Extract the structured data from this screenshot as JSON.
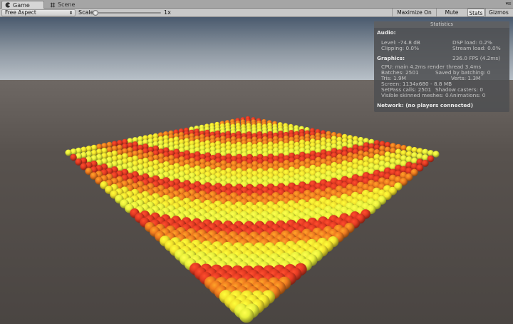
{
  "tabs": {
    "game": "Game",
    "scene": "Scene"
  },
  "toolbar": {
    "aspect": "Free Aspect",
    "scale_label": "Scale",
    "scale_value": "1x",
    "maximize_on_play": "Maximize On Play",
    "mute_audio": "Mute Audio",
    "stats": "Stats",
    "gizmos": "Gizmos"
  },
  "stats": {
    "title": "Statistics",
    "audio_header": "Audio:",
    "level": "Level: -74.8 dB",
    "clipping": "Clipping: 0.0%",
    "dsp_load": "DSP load: 0.2%",
    "stream_load": "Stream load: 0.0%",
    "graphics_header": "Graphics:",
    "fps": "236.0 FPS (4.2ms)",
    "cpu": "CPU: main 4.2ms  render thread 3.4ms",
    "batches": "Batches: 2501",
    "saved_by_batching": "Saved by batching: 0",
    "tris": "Tris: 1.9M",
    "verts": "Verts: 1.3M",
    "screen": "Screen: 1134x680 - 8.8 MB",
    "setpass": "SetPass calls: 2501",
    "shadow_casters": "Shadow casters: 0",
    "skinned_meshes": "Visible skinned meshes: 0",
    "animations": "Animations: 0",
    "network": "Network: (no players connected)"
  },
  "scene": {
    "sky_top": "#4a5a6e",
    "sky_mid": "#b8c0c8",
    "ground": "#55504c",
    "sphere_colors": [
      "#e33a22",
      "#ef7a1e",
      "#f2e22c",
      "#e8f03a"
    ]
  },
  "icons": {
    "game_tab": "pacman-icon",
    "scene_tab": "grid-icon",
    "dropdown": "dropdown-arrow-icon"
  }
}
